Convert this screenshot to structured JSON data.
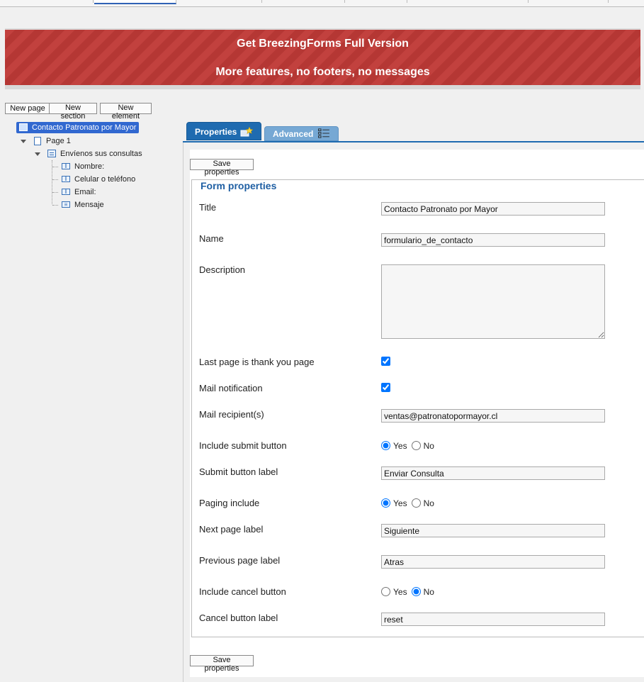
{
  "banner": {
    "line1": "Get BreezingForms Full Version",
    "line2": "More features, no footers, no messages"
  },
  "toolbar": {
    "new_page": "New page",
    "new_section": "New section",
    "new_element": "New element"
  },
  "tree": {
    "form": "Contacto Patronato por Mayor",
    "page": "Page 1",
    "section": "Envíenos sus consultas",
    "fields": [
      "Nombre:",
      "Celular o teléfono",
      "Email:",
      "Mensaje"
    ]
  },
  "tabs": {
    "properties": "Properties",
    "advanced": "Advanced"
  },
  "buttons": {
    "save_top": "Save properties",
    "save_bottom": "Save properties"
  },
  "form": {
    "legend": "Form properties",
    "title_label": "Title",
    "title_value": "Contacto Patronato por Mayor",
    "name_label": "Name",
    "name_value": "formulario_de_contacto",
    "description_label": "Description",
    "description_value": "",
    "last_page_label": "Last page is thank you page",
    "last_page_checked": true,
    "mail_notification_label": "Mail notification",
    "mail_notification_checked": true,
    "mail_recipients_label": "Mail recipient(s)",
    "mail_recipients_value": "ventas@patronatopormayor.cl",
    "include_submit_label": "Include submit button",
    "include_submit": "Yes",
    "submit_label_label": "Submit button label",
    "submit_label_value": "Enviar Consulta",
    "paging_label": "Paging include",
    "paging": "Yes",
    "next_label_label": "Next page label",
    "next_label_value": "Siguiente",
    "prev_label_label": "Previous page label",
    "prev_label_value": "Atras",
    "include_cancel_label": "Include cancel button",
    "include_cancel": "No",
    "cancel_label_label": "Cancel button label",
    "cancel_label_value": "reset",
    "yes": "Yes",
    "no": "No"
  }
}
